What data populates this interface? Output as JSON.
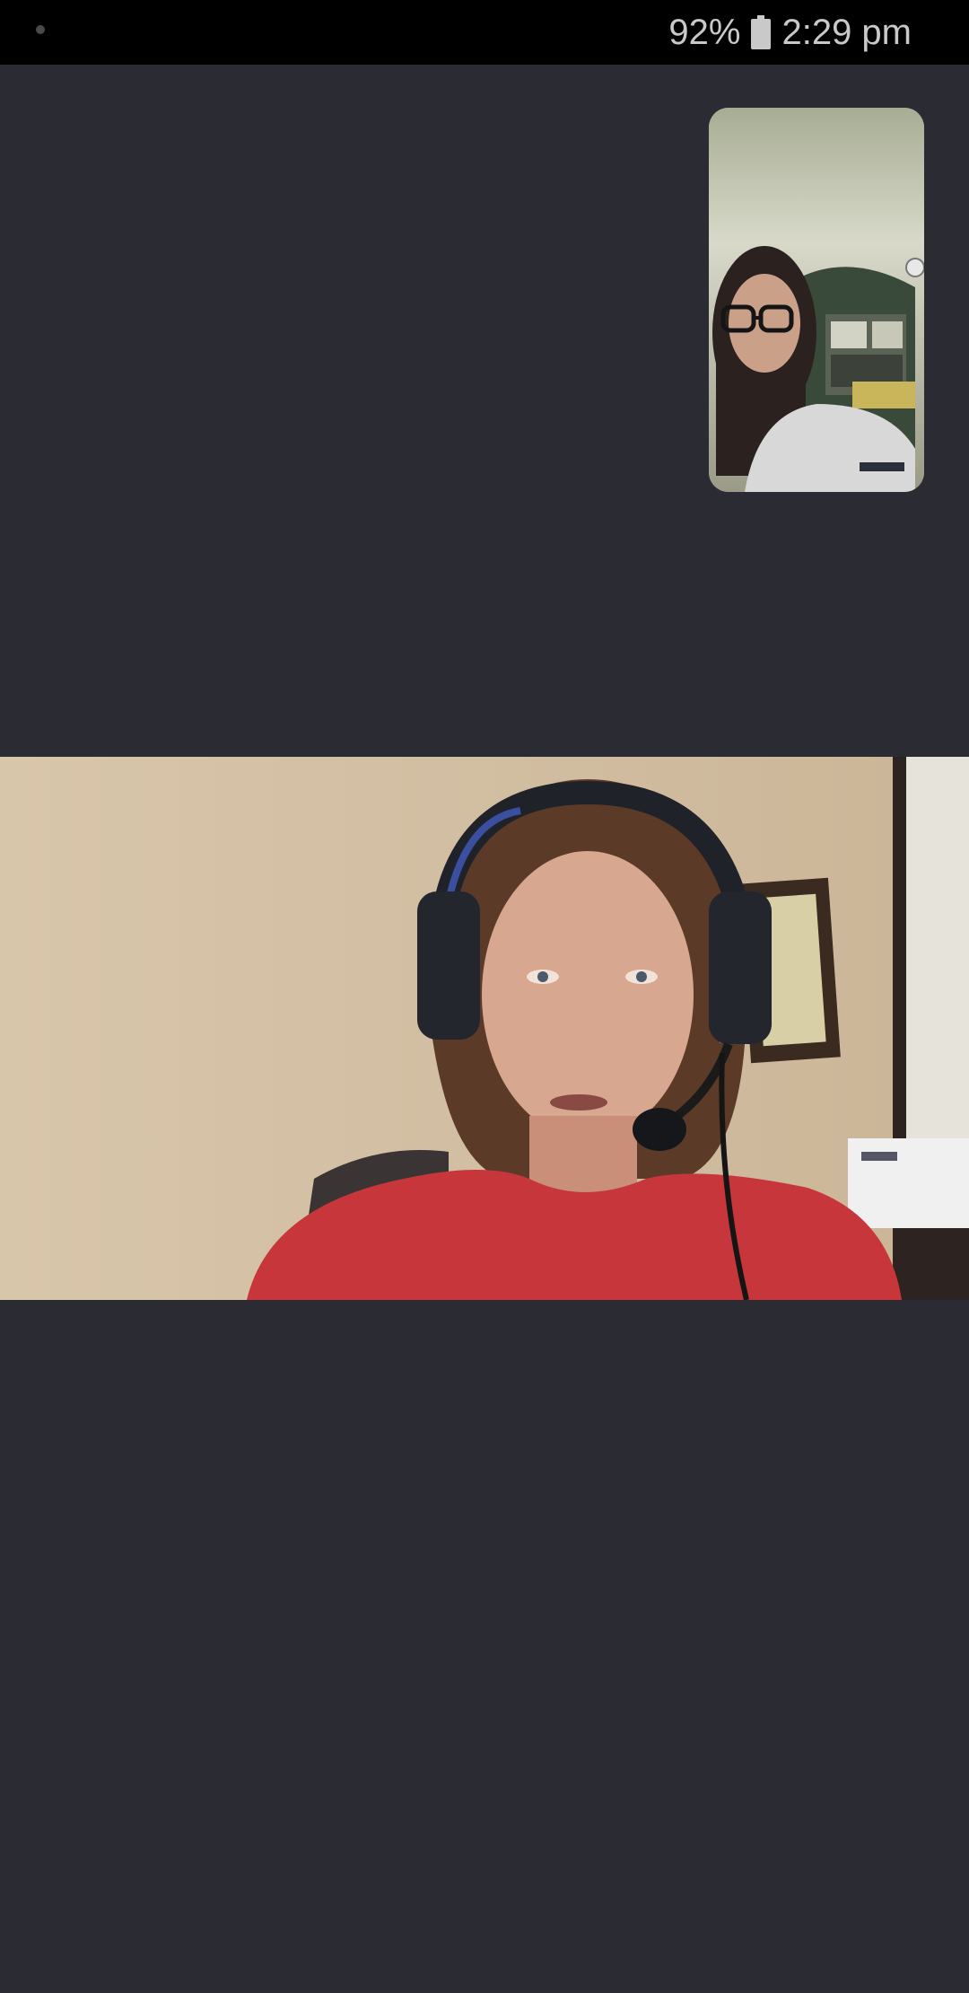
{
  "status_bar": {
    "battery": "92%",
    "time": "2:29 pm",
    "battery_icon": "battery-icon"
  },
  "call": {
    "self_view": {
      "icon": "self-video-thumbnail"
    },
    "speaker_view": {
      "icon": "remote-speaker-video"
    }
  },
  "colors": {
    "background": "#2a2b33",
    "status_bar": "#000000",
    "status_text": "#c9c9c9"
  }
}
